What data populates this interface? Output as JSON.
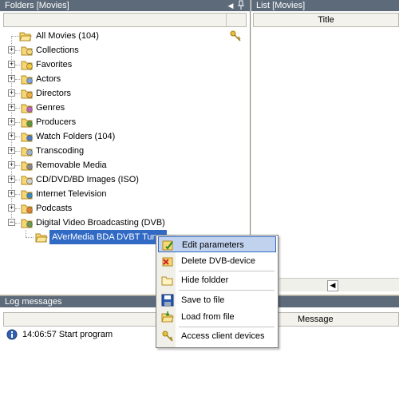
{
  "folders_pane": {
    "title": "Folders [Movies]",
    "pin_icon": "pin-icon",
    "arrow_icon": "left-arrow-icon"
  },
  "list_pane": {
    "title": "List [Movies]",
    "column_title": "Title"
  },
  "tree": {
    "root": "All Movies (104)",
    "items": [
      {
        "label": "Collections",
        "icon": "folder-collections-icon"
      },
      {
        "label": "Favorites",
        "icon": "star-icon"
      },
      {
        "label": "Actors",
        "icon": "actors-icon"
      },
      {
        "label": "Directors",
        "icon": "directors-icon"
      },
      {
        "label": "Genres",
        "icon": "genres-icon"
      },
      {
        "label": "Producers",
        "icon": "producers-icon"
      },
      {
        "label": "Watch Folders (104)",
        "icon": "watch-folders-icon"
      },
      {
        "label": "Transcoding",
        "icon": "transcoding-icon"
      },
      {
        "label": "Removable Media",
        "icon": "removable-media-icon"
      },
      {
        "label": "CD/DVD/BD Images (ISO)",
        "icon": "disc-images-icon"
      },
      {
        "label": "Internet Television",
        "icon": "internet-tv-icon"
      },
      {
        "label": "Podcasts",
        "icon": "podcasts-icon"
      },
      {
        "label": "Digital Video Broadcasting (DVB)",
        "icon": "dvb-icon"
      }
    ],
    "child": "AVerMedia BDA DVBT Tuner"
  },
  "context_menu": {
    "items": [
      {
        "label": "Edit parameters",
        "icon": "edit-parameters-icon"
      },
      {
        "label": "Delete DVB-device",
        "icon": "delete-icon"
      },
      {
        "label": "Hide foldder",
        "icon": "hide-folder-icon"
      },
      {
        "label": "Save to file",
        "icon": "floppy-disk-icon"
      },
      {
        "label": "Load from file",
        "icon": "open-folder-icon"
      },
      {
        "label": "Access client devices",
        "icon": "key-icon"
      }
    ]
  },
  "log_pane": {
    "title": "Log messages",
    "column_message": "Message",
    "entries": [
      {
        "text": "14:06:57 Start program",
        "icon": "info-icon"
      }
    ]
  },
  "colors": {
    "title_bar": "#5d6a7a",
    "selection": "#316ac5",
    "menu_hover": "#c1d2ee"
  }
}
